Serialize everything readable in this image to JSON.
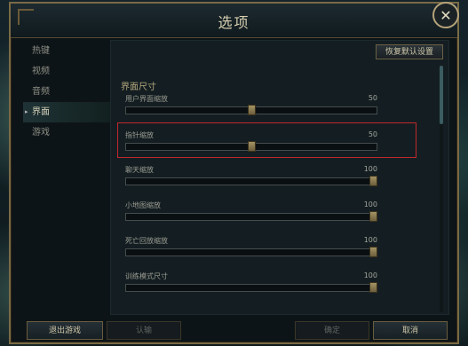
{
  "dialog": {
    "title": "选项",
    "close_glyph": "✕"
  },
  "sidebar": {
    "items": [
      {
        "label": "热键"
      },
      {
        "label": "视频"
      },
      {
        "label": "音频"
      },
      {
        "label": "界面"
      },
      {
        "label": "游戏"
      }
    ],
    "active_index": 3,
    "active_marker": "▸"
  },
  "content": {
    "reset_label": "恢复默认设置",
    "section_title": "界面尺寸",
    "settings": [
      {
        "label": "用户界面缩放",
        "value": "50",
        "fraction": 0.5
      },
      {
        "label": "指针缩放",
        "value": "50",
        "fraction": 0.5
      },
      {
        "label": "聊天缩放",
        "value": "100",
        "fraction": 1.0
      },
      {
        "label": "小地图缩放",
        "value": "100",
        "fraction": 1.0
      },
      {
        "label": "死亡回放缩放",
        "value": "100",
        "fraction": 1.0
      },
      {
        "label": "训练模式尺寸",
        "value": "100",
        "fraction": 1.0
      }
    ],
    "highlighted_index": 1
  },
  "footer": {
    "exit_label": "退出游戏",
    "surrender_label": "认输",
    "ok_label": "确定",
    "cancel_label": "取消"
  },
  "colors": {
    "highlight_border": "#c0282b",
    "gold_accent": "#7a6a45"
  }
}
